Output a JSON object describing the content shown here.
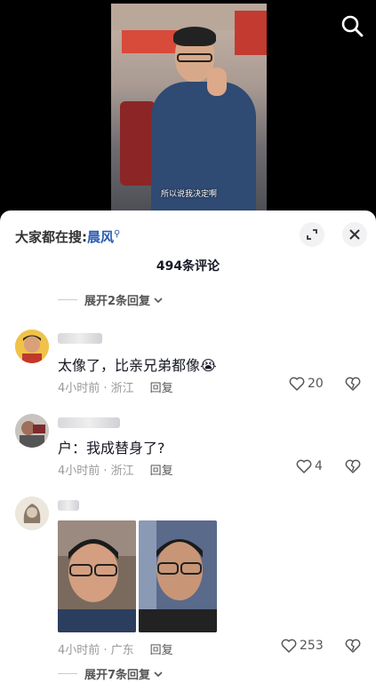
{
  "video": {
    "subtitle": "所以说我决定啊"
  },
  "panel": {
    "search_prefix": "大家都在搜:",
    "search_keyword": "晨风",
    "comment_count": "494条评论",
    "expand_top": "展开2条回复",
    "expand_bottom": "展开7条回复"
  },
  "comments": [
    {
      "text": "太像了，比亲兄弟都像😭",
      "time_location": "4小时前 · 浙江",
      "reply_label": "回复",
      "likes": "20"
    },
    {
      "text": "户：我成替身了?",
      "time_location": "4小时前 · 浙江",
      "reply_label": "回复",
      "likes": "4"
    },
    {
      "text": "",
      "time_location": "4小时前 · 广东",
      "reply_label": "回复",
      "likes": "253"
    }
  ],
  "icons": {
    "search": "search-icon",
    "fullscreen": "expand-icon",
    "close": "close-icon",
    "like": "heart-icon",
    "dislike": "broken-heart-icon",
    "chevron": "chevron-down-icon"
  }
}
